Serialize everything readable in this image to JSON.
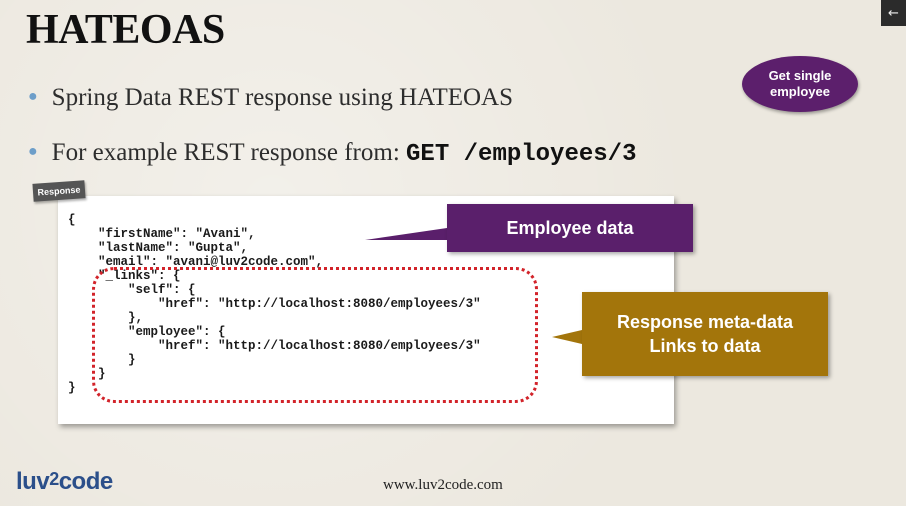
{
  "slide": {
    "title": "HATEOAS",
    "bullets": {
      "b1": "Spring Data REST response using HATEOAS",
      "b2_text": "For example REST response from:",
      "b2_code": "GET /employees/3"
    },
    "badge": {
      "line1": "Get single",
      "line2": "employee",
      "color": "#5c1f6c"
    },
    "corner_icon": "arrow-left-icon",
    "corner_glyph": "←",
    "response_tag": "Response",
    "code_lines": [
      "{",
      "    \"firstName\": \"Avani\",",
      "    \"lastName\": \"Gupta\",",
      "    \"email\": \"avani@luv2code.com\",",
      "    \"_links\": {",
      "        \"self\": {",
      "            \"href\": \"http://localhost:8080/employees/3\"",
      "        },",
      "        \"employee\": {",
      "            \"href\": \"http://localhost:8080/employees/3\"",
      "        }",
      "    }",
      "}"
    ],
    "callouts": {
      "employee_data": {
        "text": "Employee data",
        "color": "#5a1f6b"
      },
      "meta": {
        "line1": "Response meta-data",
        "line2": "Links to data",
        "color": "#a3750b"
      }
    },
    "footer": {
      "logo_a": "luv",
      "logo_2": "2",
      "logo_b": "code",
      "url": "www.luv2code.com"
    },
    "highlight_color": "#d2232a"
  }
}
